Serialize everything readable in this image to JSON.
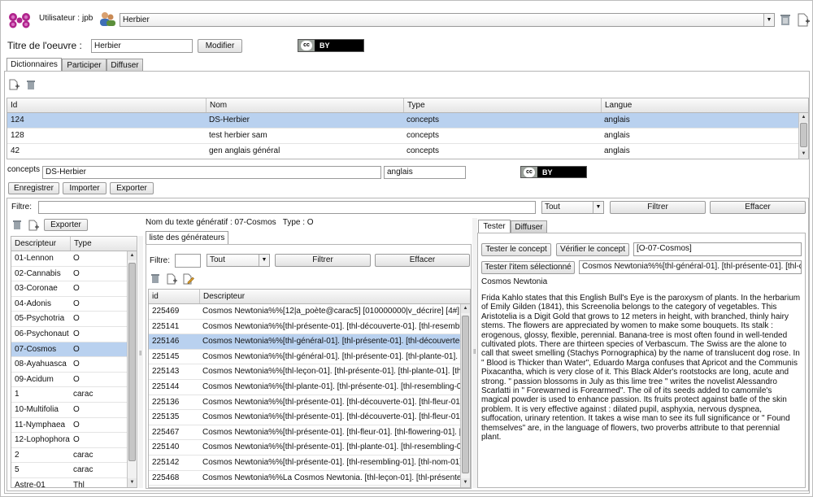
{
  "top": {
    "user_label": "Utilisateur :",
    "user_name": "jpb",
    "dictionary_select": "Herbier"
  },
  "oeuvre": {
    "label": "Titre de l'oeuvre :",
    "value": "Herbier",
    "modify_button": "Modifier",
    "license": "BY"
  },
  "main_tabs": [
    "Dictionnaires",
    "Participer",
    "Diffuser"
  ],
  "dict_table": {
    "columns": [
      "Id",
      "Nom",
      "Type",
      "Langue"
    ],
    "rows": [
      [
        "124",
        "DS-Herbier",
        "concepts",
        "anglais"
      ],
      [
        "128",
        "test herbier sam",
        "concepts",
        "anglais"
      ],
      [
        "42",
        "gen anglais général",
        "concepts",
        "anglais"
      ]
    ]
  },
  "concept_edit": {
    "type_label": "concepts",
    "name_value": "DS-Herbier",
    "lang_value": "anglais",
    "license": "BY",
    "buttons": [
      "Enregistrer",
      "Importer",
      "Exporter"
    ]
  },
  "filter": {
    "label": "Filtre:",
    "value": "",
    "select": "Tout",
    "filter_button": "Filtrer",
    "clear_button": "Effacer"
  },
  "left_list": {
    "export_button": "Exporter",
    "columns": [
      "Descripteur",
      "Type"
    ],
    "rows": [
      [
        "01-Lennon",
        "O"
      ],
      [
        "02-Cannabis",
        "O"
      ],
      [
        "03-Coronae",
        "O"
      ],
      [
        "04-Adonis",
        "O"
      ],
      [
        "05-Psychotria",
        "O"
      ],
      [
        "06-Psychonaut",
        "O"
      ],
      [
        "07-Cosmos",
        "O"
      ],
      [
        "08-Ayahuasca",
        "O"
      ],
      [
        "09-Acidum",
        "O"
      ],
      [
        "1",
        "carac"
      ],
      [
        "10-Multifolia",
        "O"
      ],
      [
        "11-Nymphaea",
        "O"
      ],
      [
        "12-Lophophora",
        "O"
      ],
      [
        "2",
        "carac"
      ],
      [
        "5",
        "carac"
      ],
      [
        "Astre-01",
        "Thl"
      ]
    ]
  },
  "generator": {
    "info": "Nom du texte génératif : 07-Cosmos   Type : O",
    "tab": "liste des générateurs",
    "filter_label": "Filtre:",
    "filter_value": "",
    "select": "Tout",
    "filter_button": "Filtrer",
    "clear_button": "Effacer",
    "columns": [
      "id",
      "Descripteur"
    ],
    "rows": [
      [
        "225469",
        "Cosmos Newtonia%%[12|a_poète@carac5] [010000000|v_décrire] [4#] [1"
      ],
      [
        "225141",
        "Cosmos Newtonia%%[thl-présente-01]. [thl-découverte-01]. [thl-resembling"
      ],
      [
        "225146",
        "Cosmos Newtonia%%[thl-général-01]. [thl-présente-01]. [thl-découverte-01"
      ],
      [
        "225145",
        "Cosmos Newtonia%%[thl-général-01]. [thl-présente-01]. [thl-plante-01]. [thl"
      ],
      [
        "225143",
        "Cosmos Newtonia%%[thl-leçon-01]. [thl-présente-01]. [thl-plante-01]. [thl-re"
      ],
      [
        "225144",
        "Cosmos Newtonia%%[thl-plante-01]. [thl-présente-01]. [thl-resembling-01]. [t"
      ],
      [
        "225136",
        "Cosmos Newtonia%%[thl-présente-01]. [thl-découverte-01]. [thl-fleur-01]. [thl"
      ],
      [
        "225135",
        "Cosmos Newtonia%%[thl-présente-01]. [thl-découverte-01]. [thl-fleur-01]. [thl"
      ],
      [
        "225467",
        "Cosmos Newtonia%%[thl-présente-01]. [thl-fleur-01]. [thl-flowering-01]. [thl-"
      ],
      [
        "225140",
        "Cosmos Newtonia%%[thl-présente-01]. [thl-plante-01]. [thl-resembling-01]. [th"
      ],
      [
        "225142",
        "Cosmos Newtonia%%[thl-présente-01]. [thl-resembling-01]. [thl-nom-01]. [thl"
      ],
      [
        "225468",
        "Cosmos Newtonia%%La Cosmos Newtonia. [thl-leçon-01]. [thl-présente-0"
      ]
    ]
  },
  "tester": {
    "tabs": [
      "Tester",
      "Diffuser"
    ],
    "test_concept_button": "Tester le concept",
    "verify_concept_button": "Vérifier le concept",
    "concept_value": "[O-07-Cosmos]",
    "test_item_button": "Tester l'item sélectionné",
    "item_value": "Cosmos Newtonia%%[thl-général-01]. [thl-présente-01]. [thl-déco",
    "result_title": "Cosmos Newtonia",
    "result_text": "Frida Kahlo states that this English Bull's Eye is the paroxysm of plants. In the herbarium of Emily Gilden (1841), this Screenolia belongs to the category of vegetables. This Aristotelia is a Digit Gold that grows to 12 meters in height, with branched, thinly hairy stems. The flowers are appreciated by women to make some bouquets. Its stalk : erogenous, glossy, flexible, perennial. Banana-tree is most often found in well-tended cultivated plots. There are thirteen species of Verbascum. The Swiss are the alone to call that sweet smelling (Stachys Pornographica) by the name of translucent dog rose. In \" Blood is Thicker than Water\", Eduardo Marga confuses that Apricot and the Communis Pixacantha, which is very close of it. This Black Alder's rootstocks are long, acute and strong. \" passion blossoms in July as this lime tree \" writes the novelist Alessandro Scarlatti in \" Forewarned is Forearmed\". The oil of its seeds added to camomile's magical powder is used to enhance passion. Its fruits protect against batle of the skin problem. It is very effective against : dilated pupil, asphyxia, nervous dyspnea, suffocation, urinary retention. It takes a wise man to see its full significance or \" Found themselves\" are, in the language of flowers, two proverbs attribute to that perennial plant."
  },
  "colors": {
    "selected_row": "#b9d1ef",
    "logo": "#b0248c"
  }
}
